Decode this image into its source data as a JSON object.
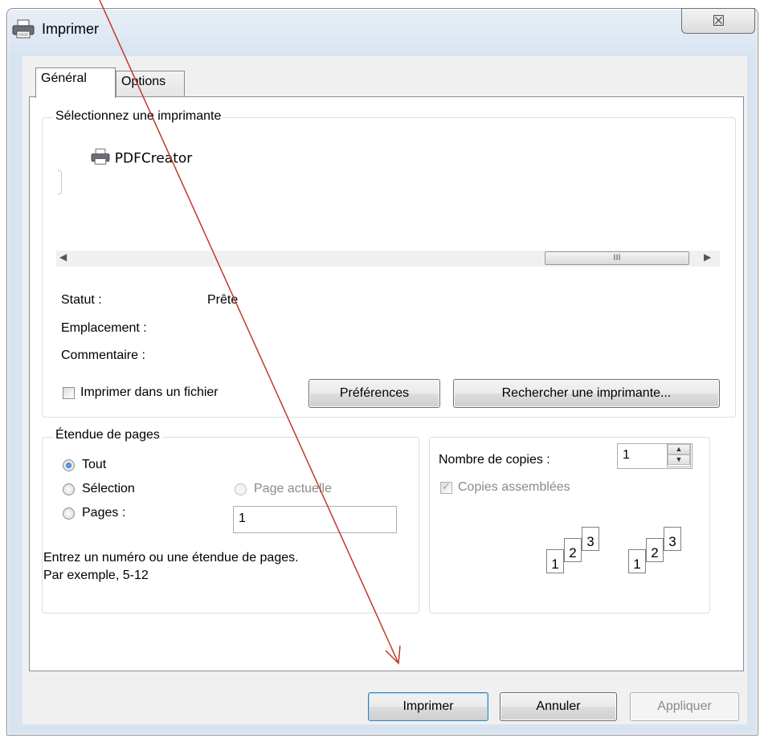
{
  "window": {
    "title": "Imprimer",
    "close_glyph": "☒"
  },
  "tabs": [
    {
      "label": "Général",
      "active": true
    },
    {
      "label": "Options",
      "active": false
    }
  ],
  "printer_group": {
    "legend": "Sélectionnez une imprimante",
    "printers": [
      "PDFCreator"
    ],
    "status_label": "Statut :",
    "status_value": "Prête",
    "location_label": "Emplacement :",
    "location_value": "",
    "comment_label": "Commentaire :",
    "comment_value": "",
    "print_to_file_label": "Imprimer dans un fichier",
    "print_to_file_checked": false,
    "preferences_button": "Préférences",
    "find_printer_button": "Rechercher une imprimante...",
    "scroll_thumb_glyph": "III"
  },
  "page_range": {
    "legend": "Étendue de pages",
    "all_label": "Tout",
    "selection_label": "Sélection",
    "current_page_label": "Page actuelle",
    "pages_label": "Pages :",
    "pages_value": "1",
    "hint_line1": "Entrez un numéro ou une étendue de pages.",
    "hint_line2": "Par exemple, 5-12",
    "selected": "Tout"
  },
  "copies": {
    "count_label": "Nombre de copies :",
    "count_value": "1",
    "collate_label": "Copies assemblées",
    "collate_checked": true,
    "collate_enabled": false,
    "page_numbers": [
      "1",
      "2",
      "3"
    ]
  },
  "footer": {
    "print_button": "Imprimer",
    "cancel_button": "Annuler",
    "apply_button": "Appliquer"
  },
  "annotation": {
    "arrow_color": "#c0392b"
  }
}
